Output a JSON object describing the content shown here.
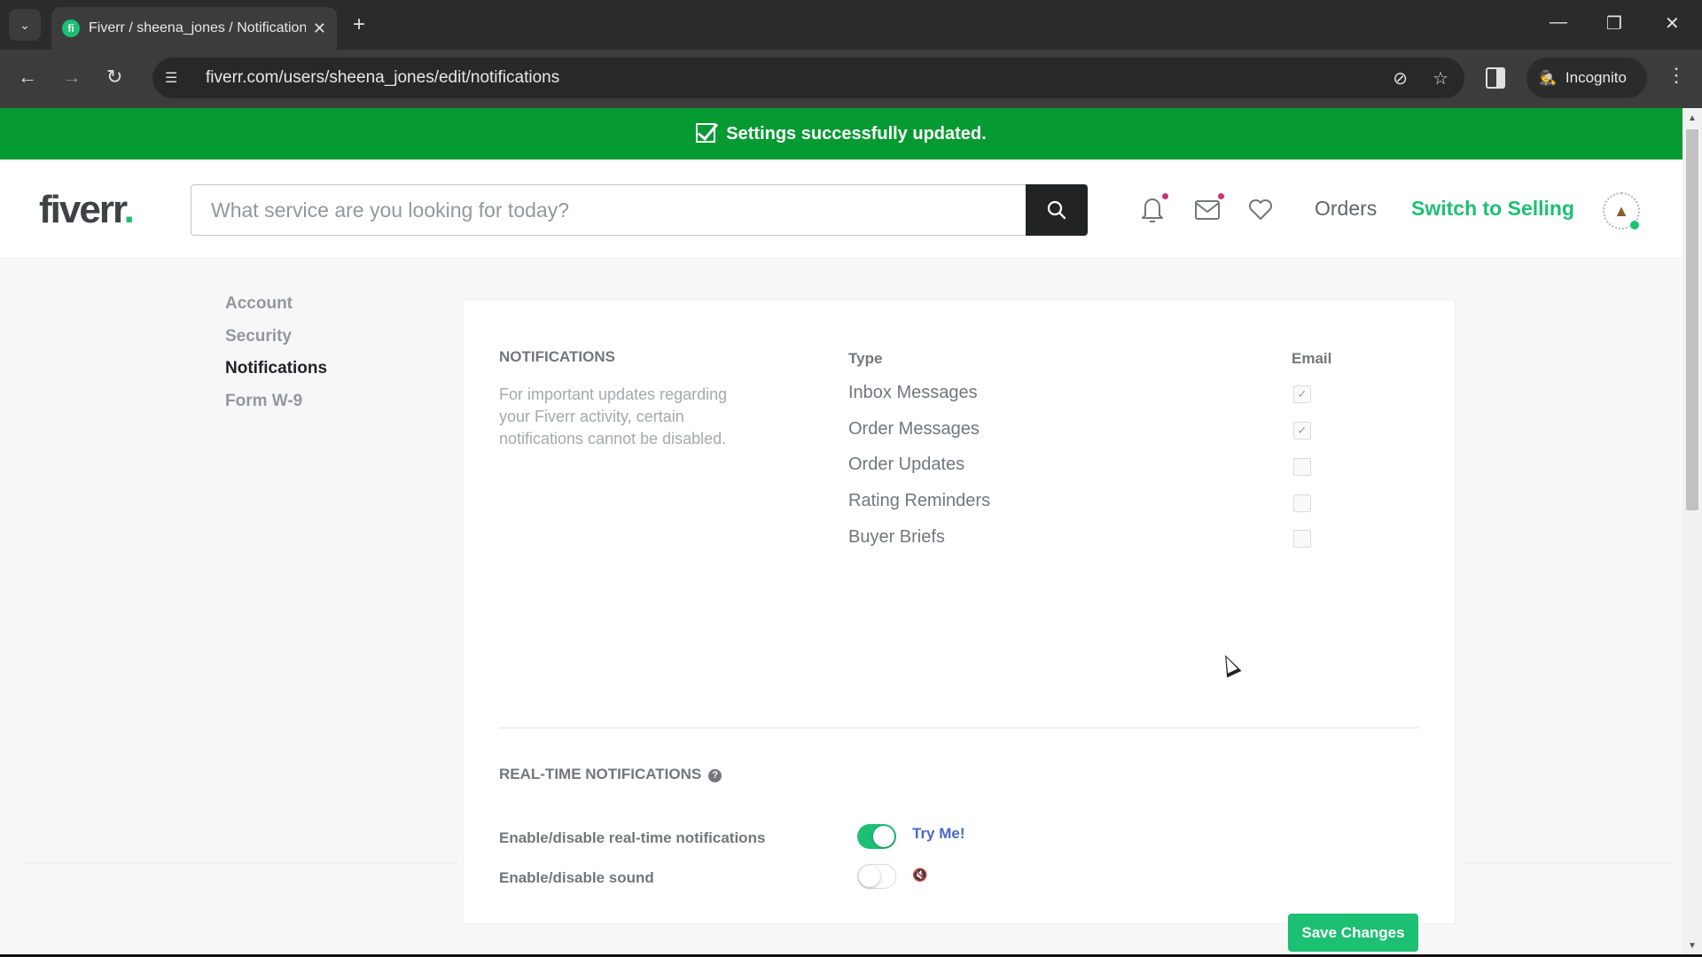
{
  "browser": {
    "tab_title": "Fiverr / sheena_jones / Notifications",
    "tab_favicon": "fi",
    "url": "fiverr.com/users/sheena_jones/edit/notifications",
    "incognito_label": "Incognito"
  },
  "banner": {
    "message": "Settings successfully updated.",
    "color": "#069a32"
  },
  "header": {
    "logo": "fiverr",
    "logo_dot": ".",
    "search_placeholder": "What service are you looking for today?",
    "orders_label": "Orders",
    "switch_label": "Switch to Selling",
    "accent_color": "#1dbf73"
  },
  "sidebar": {
    "items": [
      {
        "label": "Account",
        "active": false
      },
      {
        "label": "Security",
        "active": false
      },
      {
        "label": "Notifications",
        "active": true
      },
      {
        "label": "Form W-9",
        "active": false
      }
    ]
  },
  "notifications": {
    "title": "NOTIFICATIONS",
    "description": "For important updates regarding your Fiverr activity, certain notifications cannot be disabled.",
    "col_type": "Type",
    "col_email": "Email",
    "rows": [
      {
        "type": "Inbox Messages",
        "email": true
      },
      {
        "type": "Order Messages",
        "email": true
      },
      {
        "type": "Order Updates",
        "email": false
      },
      {
        "type": "Rating Reminders",
        "email": false
      },
      {
        "type": "Buyer Briefs",
        "email": false
      }
    ]
  },
  "realtime": {
    "title": "REAL-TIME NOTIFICATIONS",
    "realtime_label": "Enable/disable real-time notifications",
    "realtime_enabled": true,
    "try_me": "Try Me!",
    "sound_label": "Enable/disable sound",
    "sound_enabled": false
  },
  "actions": {
    "save_label": "Save Changes"
  }
}
